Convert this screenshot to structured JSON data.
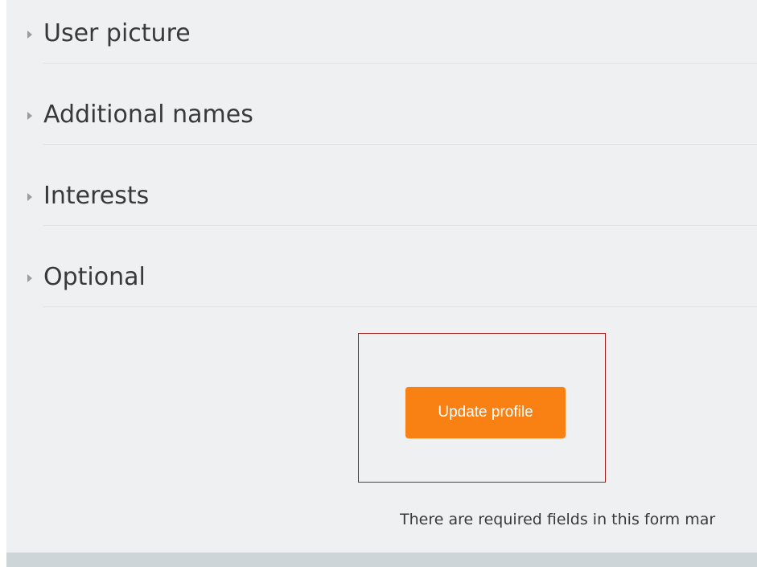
{
  "sections": [
    {
      "title": "User picture"
    },
    {
      "title": "Additional names"
    },
    {
      "title": "Interests"
    },
    {
      "title": "Optional"
    }
  ],
  "actions": {
    "update_label": "Update profile"
  },
  "footer": {
    "required_note": "There are required fields in this form mar"
  },
  "colors": {
    "panel_background": "#eef0f1",
    "primary_button": "#f98012",
    "highlight_border": "#9f1c1c",
    "text": "#373a3c"
  },
  "icons": {
    "section_toggle": "caret-right-icon"
  }
}
